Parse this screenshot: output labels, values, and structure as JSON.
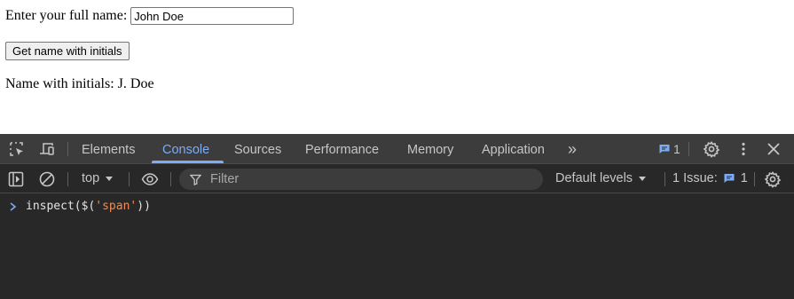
{
  "page": {
    "name_label": "Enter your full name:",
    "name_value": "John Doe",
    "button_label": "Get name with initials",
    "result_label": "Name with initials:",
    "result_value": "J. Doe"
  },
  "devtools": {
    "tabs": [
      "Elements",
      "Console",
      "Sources",
      "Performance",
      "Memory",
      "Application"
    ],
    "active_tab": "Console",
    "more_tabs_glyph": "»",
    "issues_badge_count": "1",
    "toolbar": {
      "context": "top",
      "filter_placeholder": "Filter",
      "levels": "Default levels",
      "issues_label": "1 Issue:",
      "issues_count": "1"
    },
    "console": {
      "prompt_prefix": "inspect($(",
      "prompt_string": "'span'",
      "prompt_suffix": "))"
    },
    "colors": {
      "accent": "#7cacf8",
      "tabbar_bg": "#3c3c3c",
      "panel_bg": "#282828",
      "text": "#c6c6c6",
      "string": "#f28b54"
    },
    "icons": [
      "inspect-element-icon",
      "device-toolbar-icon",
      "more-tabs-icon",
      "issues-icon",
      "settings-icon",
      "kebab-menu-icon",
      "close-icon",
      "sidebar-toggle-icon",
      "clear-console-icon",
      "dropdown-caret-icon",
      "eye-icon",
      "filter-icon",
      "console-settings-icon",
      "prompt-chevron-icon"
    ]
  }
}
